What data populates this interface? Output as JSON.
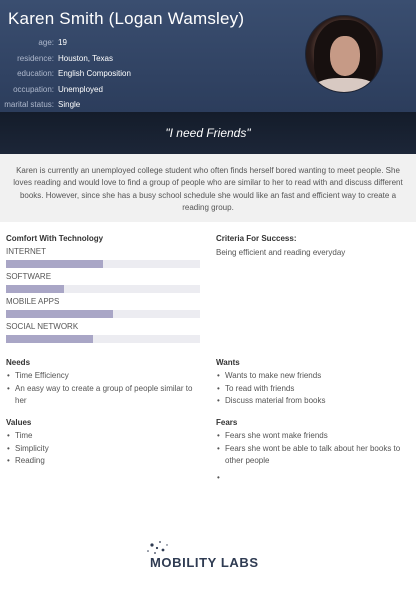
{
  "persona": {
    "name": "Karen Smith (Logan Wamsley)",
    "facts": [
      {
        "label": "age:",
        "value": "19"
      },
      {
        "label": "residence:",
        "value": "Houston, Texas"
      },
      {
        "label": "education:",
        "value": "English Composition"
      },
      {
        "label": "occupation:",
        "value": "Unemployed"
      },
      {
        "label": "marital status:",
        "value": "Single"
      }
    ],
    "quote": "\"I need Friends\"",
    "bio": "Karen is currently an unemployed college student who often finds herself bored wanting to meet people. She loves reading and would love to find a group of people who are similar to her to read with and discuss different books. However, since she has a busy school schedule she would like an fast and efficient way to create a reading group."
  },
  "comfort": {
    "title": "Comfort With Technology",
    "skills": [
      {
        "label": "INTERNET",
        "level": 0.5
      },
      {
        "label": "SOFTWARE",
        "level": 0.3
      },
      {
        "label": "MOBILE APPS",
        "level": 0.55
      },
      {
        "label": "SOCIAL NETWORK",
        "level": 0.45
      }
    ]
  },
  "criteria": {
    "title": "Criteria For Success:",
    "text": "Being efficient and reading everyday"
  },
  "needs": {
    "title": "Needs",
    "items": [
      "Time Efficiency",
      "An easy way to create a group of people similar to her"
    ]
  },
  "wants": {
    "title": "Wants",
    "items": [
      "Wants to make new friends",
      "To read with friends",
      "Discuss material from books"
    ]
  },
  "values": {
    "title": "Values",
    "items": [
      "Time",
      "Simplicity",
      "Reading"
    ]
  },
  "fears": {
    "title": "Fears",
    "items": [
      "Fears she wont make friends",
      "Fears she wont be able to talk about her books to other people",
      ""
    ]
  },
  "footer": {
    "logo_text": "MOBILITY LABS",
    "logo_color": "#2f3b52"
  },
  "colors": {
    "header": "#34476a",
    "quote_band": "#182233",
    "bar_fill": "#a9a6c6"
  }
}
